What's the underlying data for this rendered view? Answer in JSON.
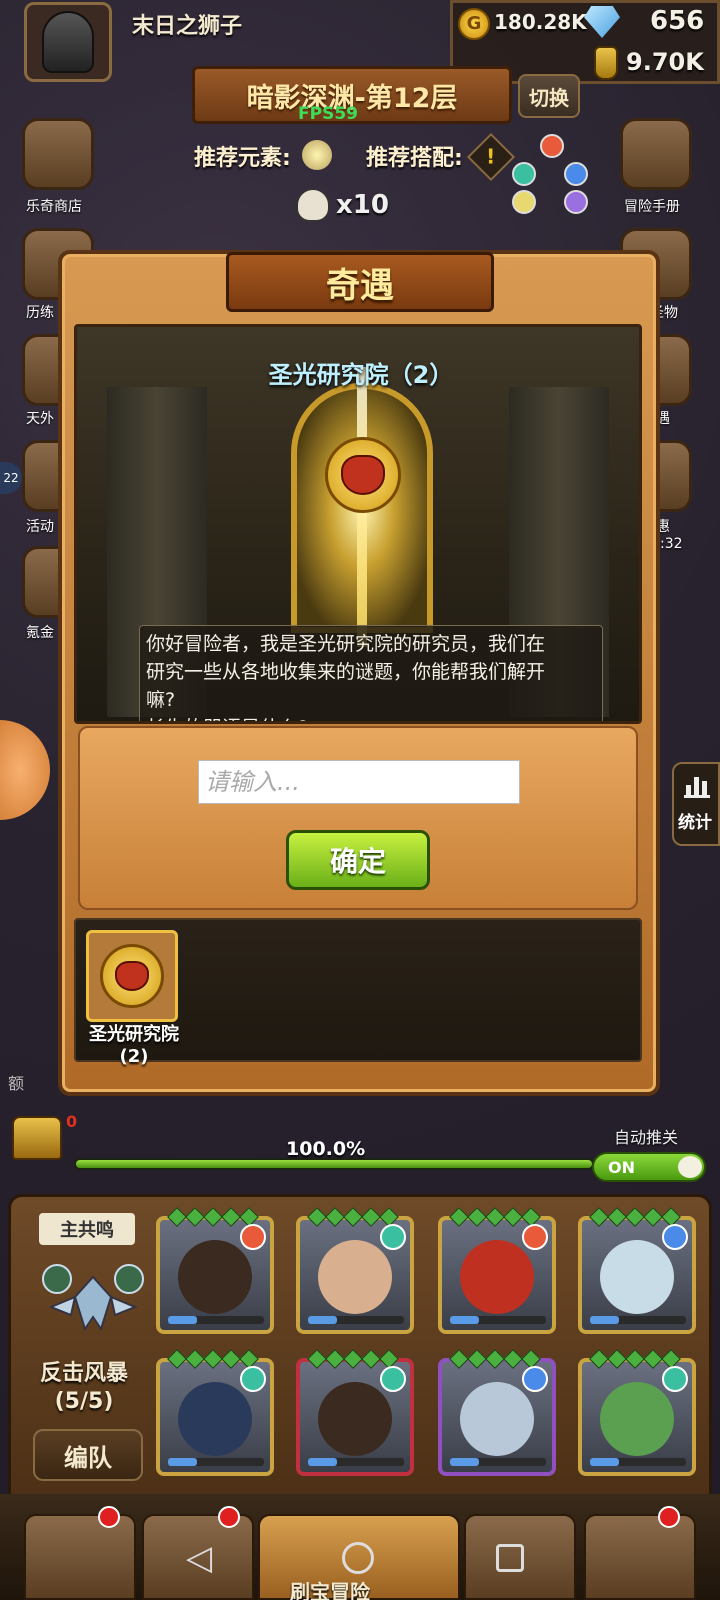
{
  "topbar": {
    "player_name": "末日之狮子",
    "coins": "180.28K",
    "gems": "656",
    "potions": "9.70K",
    "coin_glyph": "G"
  },
  "stage": {
    "level_title": "暗影深渊-第12层",
    "fps": "FPS59",
    "switch_label": "切换",
    "rec_element_label": "推荐元素:",
    "rec_combo_label": "推荐搭配:",
    "rec_combo_glyph": "!",
    "skull_count": "x10"
  },
  "side_left": [
    {
      "label": "乐奇商店"
    },
    {
      "label": "历练"
    },
    {
      "label": "天外"
    },
    {
      "label": "活动"
    },
    {
      "label": "氪金"
    }
  ],
  "side_right": [
    {
      "label": "冒险手册"
    },
    {
      "label": "圣物"
    },
    {
      "label": "遇"
    },
    {
      "label": "惠"
    },
    {
      "label": ":32"
    }
  ],
  "side_misc": {
    "left_badge": "22",
    "extra_label": "额"
  },
  "modal": {
    "title": "奇遇",
    "scene_title": "圣光研究院（2）",
    "dialog_line1": "你好冒险者，我是圣光研究院的研究员，我们在",
    "dialog_line2": "研究一些从各地收集来的谜题，你能帮我们解开",
    "dialog_line3": "嘛?",
    "dialog_line4": "长生的咒语是什么?",
    "input_placeholder": "请输入...",
    "input_value": "",
    "confirm_label": "确定",
    "record_label_line1": "圣光研究院",
    "record_label_line2": "(2)"
  },
  "progress": {
    "percent_text": "100.0%",
    "value": 1.0,
    "chest_count": "0",
    "auto_label": "自动推关",
    "toggle_state": "ON"
  },
  "stats": {
    "label": "统计"
  },
  "team": {
    "resonance_label": "主共鸣",
    "storm_name": "反击风暴",
    "storm_count": "(5/5)",
    "team_button": "编队"
  },
  "heroes": [
    {
      "element": "fire",
      "color": "#e85a3a"
    },
    {
      "element": "wind",
      "color": "#3ac0a0"
    },
    {
      "element": "fire",
      "color": "#e85a3a"
    },
    {
      "element": "water",
      "color": "#4a8ae8"
    },
    {
      "element": "wind",
      "color": "#3ac0a0"
    },
    {
      "element": "wind",
      "color": "#3ac0a0"
    },
    {
      "element": "water",
      "color": "#4a8ae8"
    },
    {
      "element": "wind",
      "color": "#3ac0a0"
    }
  ],
  "nav": {
    "active_tab_label": "刷宝冒险",
    "back_glyph": "◁"
  },
  "colors": {
    "modal_orange": "#d89a52",
    "confirm_green": "#6ab018",
    "scene_title_blue": "#bff0ff"
  }
}
